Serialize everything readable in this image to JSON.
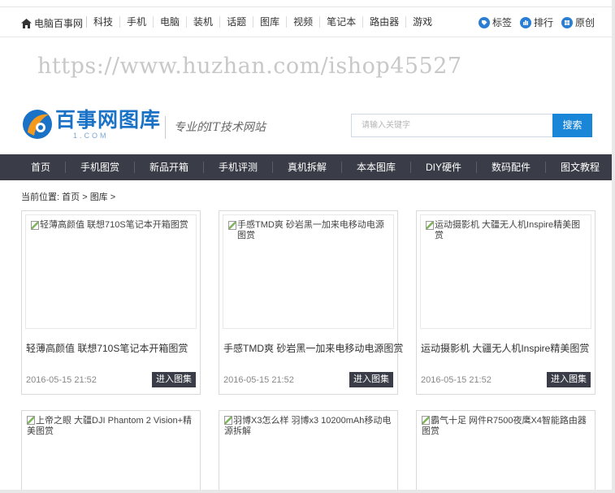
{
  "topbar": {
    "site_name": "电脑百事网",
    "nav": [
      "科技",
      "手机",
      "电脑",
      "装机",
      "话题",
      "图库",
      "视频",
      "笔记本",
      "路由器",
      "游戏"
    ],
    "right": [
      "标签",
      "排行",
      "原创"
    ]
  },
  "watermark": "https://www.huzhan.com/ishop45527",
  "logo": {
    "name": "百事网图库",
    "domain_text": "1.COM",
    "slogan": "专业的IT技术网站"
  },
  "search": {
    "placeholder": "请输入关键字",
    "button": "搜索"
  },
  "mainnav": [
    "首页",
    "手机图赏",
    "新品开箱",
    "手机评测",
    "真机拆解",
    "本本图库",
    "DIY硬件",
    "数码配件",
    "图文教程"
  ],
  "breadcrumb": {
    "label": "当前位置:",
    "items": [
      "首页",
      "图库"
    ],
    "sep": ">"
  },
  "cards": [
    {
      "alt": "轻薄高颜值 联想710S笔记本开箱图赏",
      "title": "轻薄高颜值 联想710S笔记本开箱图赏",
      "date": "2016-05-15 21:52",
      "button": "进入图集"
    },
    {
      "alt": "手感TMD爽 砂岩黑一加来电移动电源图赏",
      "title": "手感TMD爽 砂岩黑一加来电移动电源图赏",
      "date": "2016-05-15 21:52",
      "button": "进入图集"
    },
    {
      "alt": "运动摄影机 大疆无人机Inspire精美图赏",
      "title": "运动摄影机 大疆无人机Inspire精美图赏",
      "date": "2016-05-15 21:52",
      "button": "进入图集"
    }
  ],
  "cards_row2": [
    {
      "alt": "上帝之眼 大疆DJI Phantom 2 Vision+精美图赏"
    },
    {
      "alt": "羽博X3怎么样 羽博x3 10200mAh移动电源拆解"
    },
    {
      "alt": "霸气十足 网件R7500夜鹰X4智能路由器图赏"
    }
  ],
  "colors": {
    "accent": "#1a86d8",
    "nav_bg": "#3a3d47",
    "logo_blue": "#1a72c7",
    "logo_orange": "#f39a1e"
  }
}
